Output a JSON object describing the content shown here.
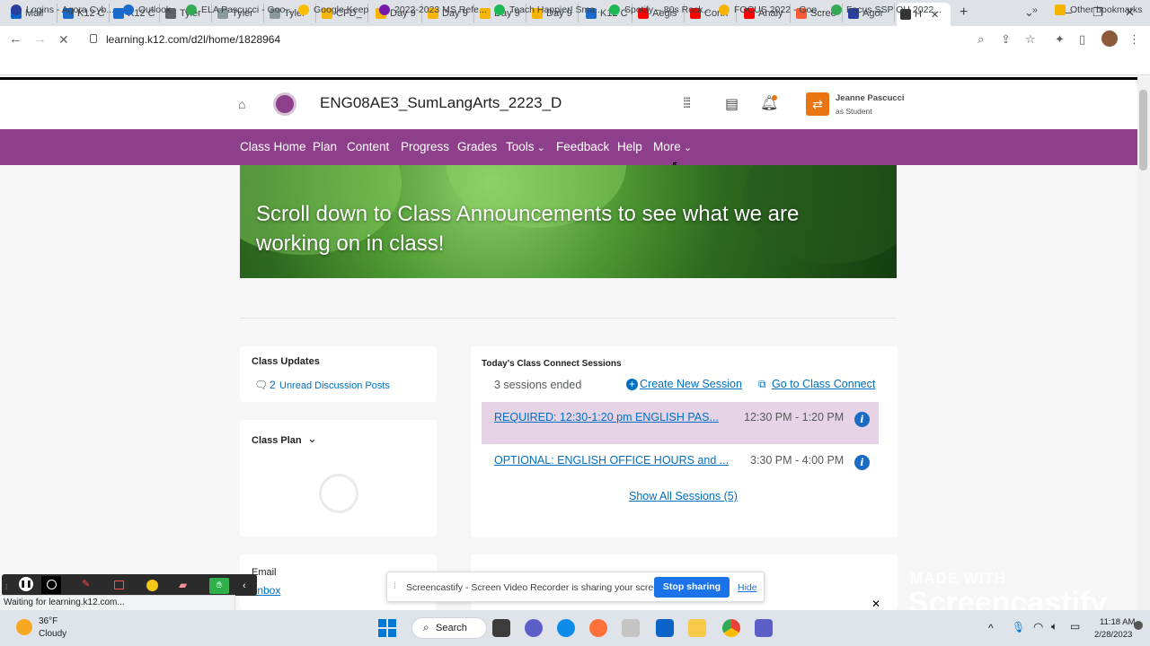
{
  "browser": {
    "tabs": [
      {
        "label": "Mail",
        "favicon": "outlook-icon",
        "color": "#0a64c8"
      },
      {
        "label": "K12 C",
        "favicon": "k12-icon",
        "color": "#1b6ac9"
      },
      {
        "label": "K12 C",
        "favicon": "k12-icon",
        "color": "#1b6ac9"
      },
      {
        "label": "Tyler",
        "favicon": "globe-icon",
        "color": "#5f6368"
      },
      {
        "label": "Tyler",
        "favicon": "tyler-icon",
        "color": "#8a9a9a"
      },
      {
        "label": "Tyler",
        "favicon": "tyler-icon",
        "color": "#8a9a9a"
      },
      {
        "label": "CFD_",
        "favicon": "slides-icon",
        "color": "#f4b400"
      },
      {
        "label": "Day 9",
        "favicon": "slides-icon",
        "color": "#f4b400"
      },
      {
        "label": "Day 9",
        "favicon": "slides-icon",
        "color": "#f4b400"
      },
      {
        "label": "Day 9",
        "favicon": "slides-icon",
        "color": "#f4b400"
      },
      {
        "label": "Day 9",
        "favicon": "slides-icon",
        "color": "#f4b400"
      },
      {
        "label": "K12 C",
        "favicon": "k12-icon",
        "color": "#1b6ac9"
      },
      {
        "label": "Aegis",
        "favicon": "youtube-icon",
        "color": "#ff0000"
      },
      {
        "label": "Conn",
        "favicon": "youtube-icon",
        "color": "#ff0000"
      },
      {
        "label": "Analy",
        "favicon": "youtube-icon",
        "color": "#ff0000"
      },
      {
        "label": "Scree",
        "favicon": "screencastify-icon",
        "color": "#ff5a36"
      },
      {
        "label": "Agor",
        "favicon": "agora-icon",
        "color": "#2a3f9d"
      },
      {
        "label": "H",
        "favicon": "d2l-icon",
        "color": "#333333",
        "active": true
      }
    ],
    "url": "learning.k12.com/d2l/home/1828964",
    "bookmarks": [
      {
        "label": "Logins - Agora Cyb...",
        "icon": "agora-icon",
        "color": "#2a3f9d"
      },
      {
        "label": "Outlook",
        "icon": "k12-icon",
        "color": "#1b6ac9"
      },
      {
        "label": "ELA Pascucci - Goo...",
        "icon": "drive-icon",
        "color": "#34a853"
      },
      {
        "label": "Google Keep",
        "icon": "keep-icon",
        "color": "#fbbc04"
      },
      {
        "label": "2022-2023 MS Refe...",
        "icon": "onenote-icon",
        "color": "#7719aa"
      },
      {
        "label": "Teach Happier! Sma...",
        "icon": "spotify-icon",
        "color": "#1db954"
      },
      {
        "label": "Spotify – 80s Rock...",
        "icon": "spotify-icon",
        "color": "#1db954"
      },
      {
        "label": "FOCUS 2022 - Goo...",
        "icon": "slides-icon",
        "color": "#f4b400"
      },
      {
        "label": "Focus SSP OH 2022...",
        "icon": "drive-icon",
        "color": "#34a853"
      }
    ],
    "more_bookmarks": "»",
    "other_bookmarks": "Other bookmarks",
    "status_text": "Waiting for learning.k12.com..."
  },
  "lms": {
    "course_title": "ENG08AE3_SumLangArts_2223_D",
    "user_name": "Jeanne Pascucci",
    "user_role": "as Student",
    "nav": [
      {
        "label": "Class Home"
      },
      {
        "label": "Plan"
      },
      {
        "label": "Content"
      },
      {
        "label": "Progress"
      },
      {
        "label": "Grades"
      },
      {
        "label": "Tools",
        "dropdown": true
      },
      {
        "label": "Feedback"
      },
      {
        "label": "Help"
      },
      {
        "label": "More",
        "dropdown": true
      }
    ],
    "banner_text": "Scroll down to Class Announcements to see what we are working on in class!",
    "class_updates": {
      "title": "Class Updates",
      "count": "2",
      "link": "Unread Discussion Posts"
    },
    "class_plan": {
      "title": "Class Plan"
    },
    "email": {
      "title": "Email",
      "link": "Inbox"
    },
    "sessions": {
      "title": "Today's Class Connect Sessions",
      "ended": "3 sessions ended",
      "create_link": "Create New Session",
      "goto_link": "Go to Class Connect",
      "items": [
        {
          "name": "REQUIRED: 12:30-1:20 pm ENGLISH PAS...",
          "time": "12:30 PM - 1:20 PM"
        },
        {
          "name": "OPTIONAL: ENGLISH OFFICE HOURS and ...",
          "time": "3:30 PM - 4:00 PM"
        }
      ],
      "show_all": "Show All Sessions (5)"
    }
  },
  "screencastify": {
    "share_text": "Screencastify - Screen Video Recorder is sharing your screen.",
    "stop_label": "Stop sharing",
    "hide_label": "Hide",
    "watermark_small": "MADE WITH",
    "watermark_big": "Screencastify"
  },
  "taskbar": {
    "weather_temp": "36°F",
    "weather_desc": "Cloudy",
    "search_label": "Search",
    "time": "11:18 AM",
    "date": "2/28/2023"
  },
  "colors": {
    "lms_purple": "#8d3f8b",
    "link_blue": "#006fbf",
    "session_highlight": "#e6d3e6",
    "stop_button": "#1a73e8"
  }
}
